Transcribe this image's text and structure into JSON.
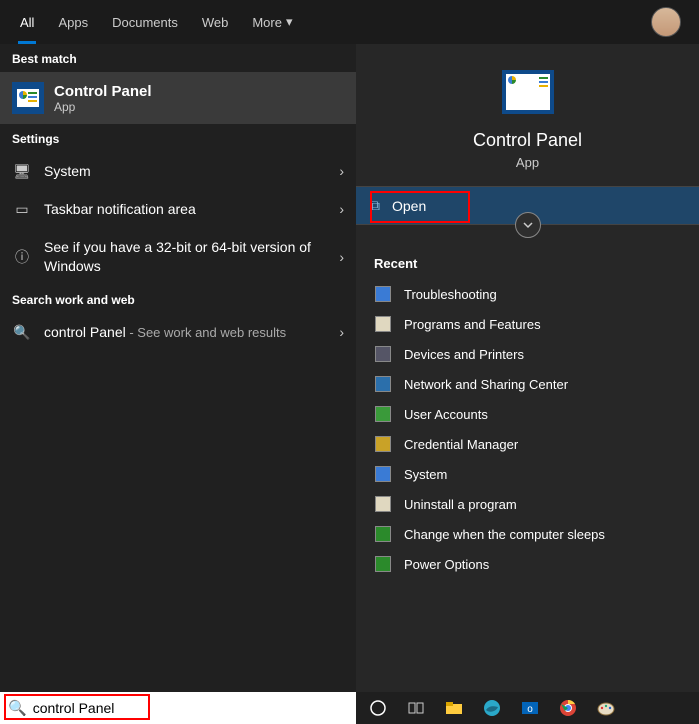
{
  "tabs": {
    "all": "All",
    "apps": "Apps",
    "documents": "Documents",
    "web": "Web",
    "more": "More"
  },
  "left": {
    "best_match_label": "Best match",
    "result": {
      "title": "Control Panel",
      "subtitle": "App"
    },
    "settings_label": "Settings",
    "settings": [
      {
        "icon": "monitor",
        "label": "System"
      },
      {
        "icon": "taskbar",
        "label": "Taskbar notification area"
      },
      {
        "icon": "info",
        "label": "See if you have a 32-bit or 64-bit version of Windows"
      }
    ],
    "web_label": "Search work and web",
    "web_item": {
      "label": "control Panel",
      "suffix": " - See work and web results"
    }
  },
  "preview": {
    "title": "Control Panel",
    "subtitle": "App",
    "open": "Open"
  },
  "recent": {
    "label": "Recent",
    "items": [
      "Troubleshooting",
      "Programs and Features",
      "Devices and Printers",
      "Network and Sharing Center",
      "User Accounts",
      "Credential Manager",
      "System",
      "Uninstall a program",
      "Change when the computer sleeps",
      "Power Options"
    ]
  },
  "search": {
    "value": "control Panel"
  }
}
